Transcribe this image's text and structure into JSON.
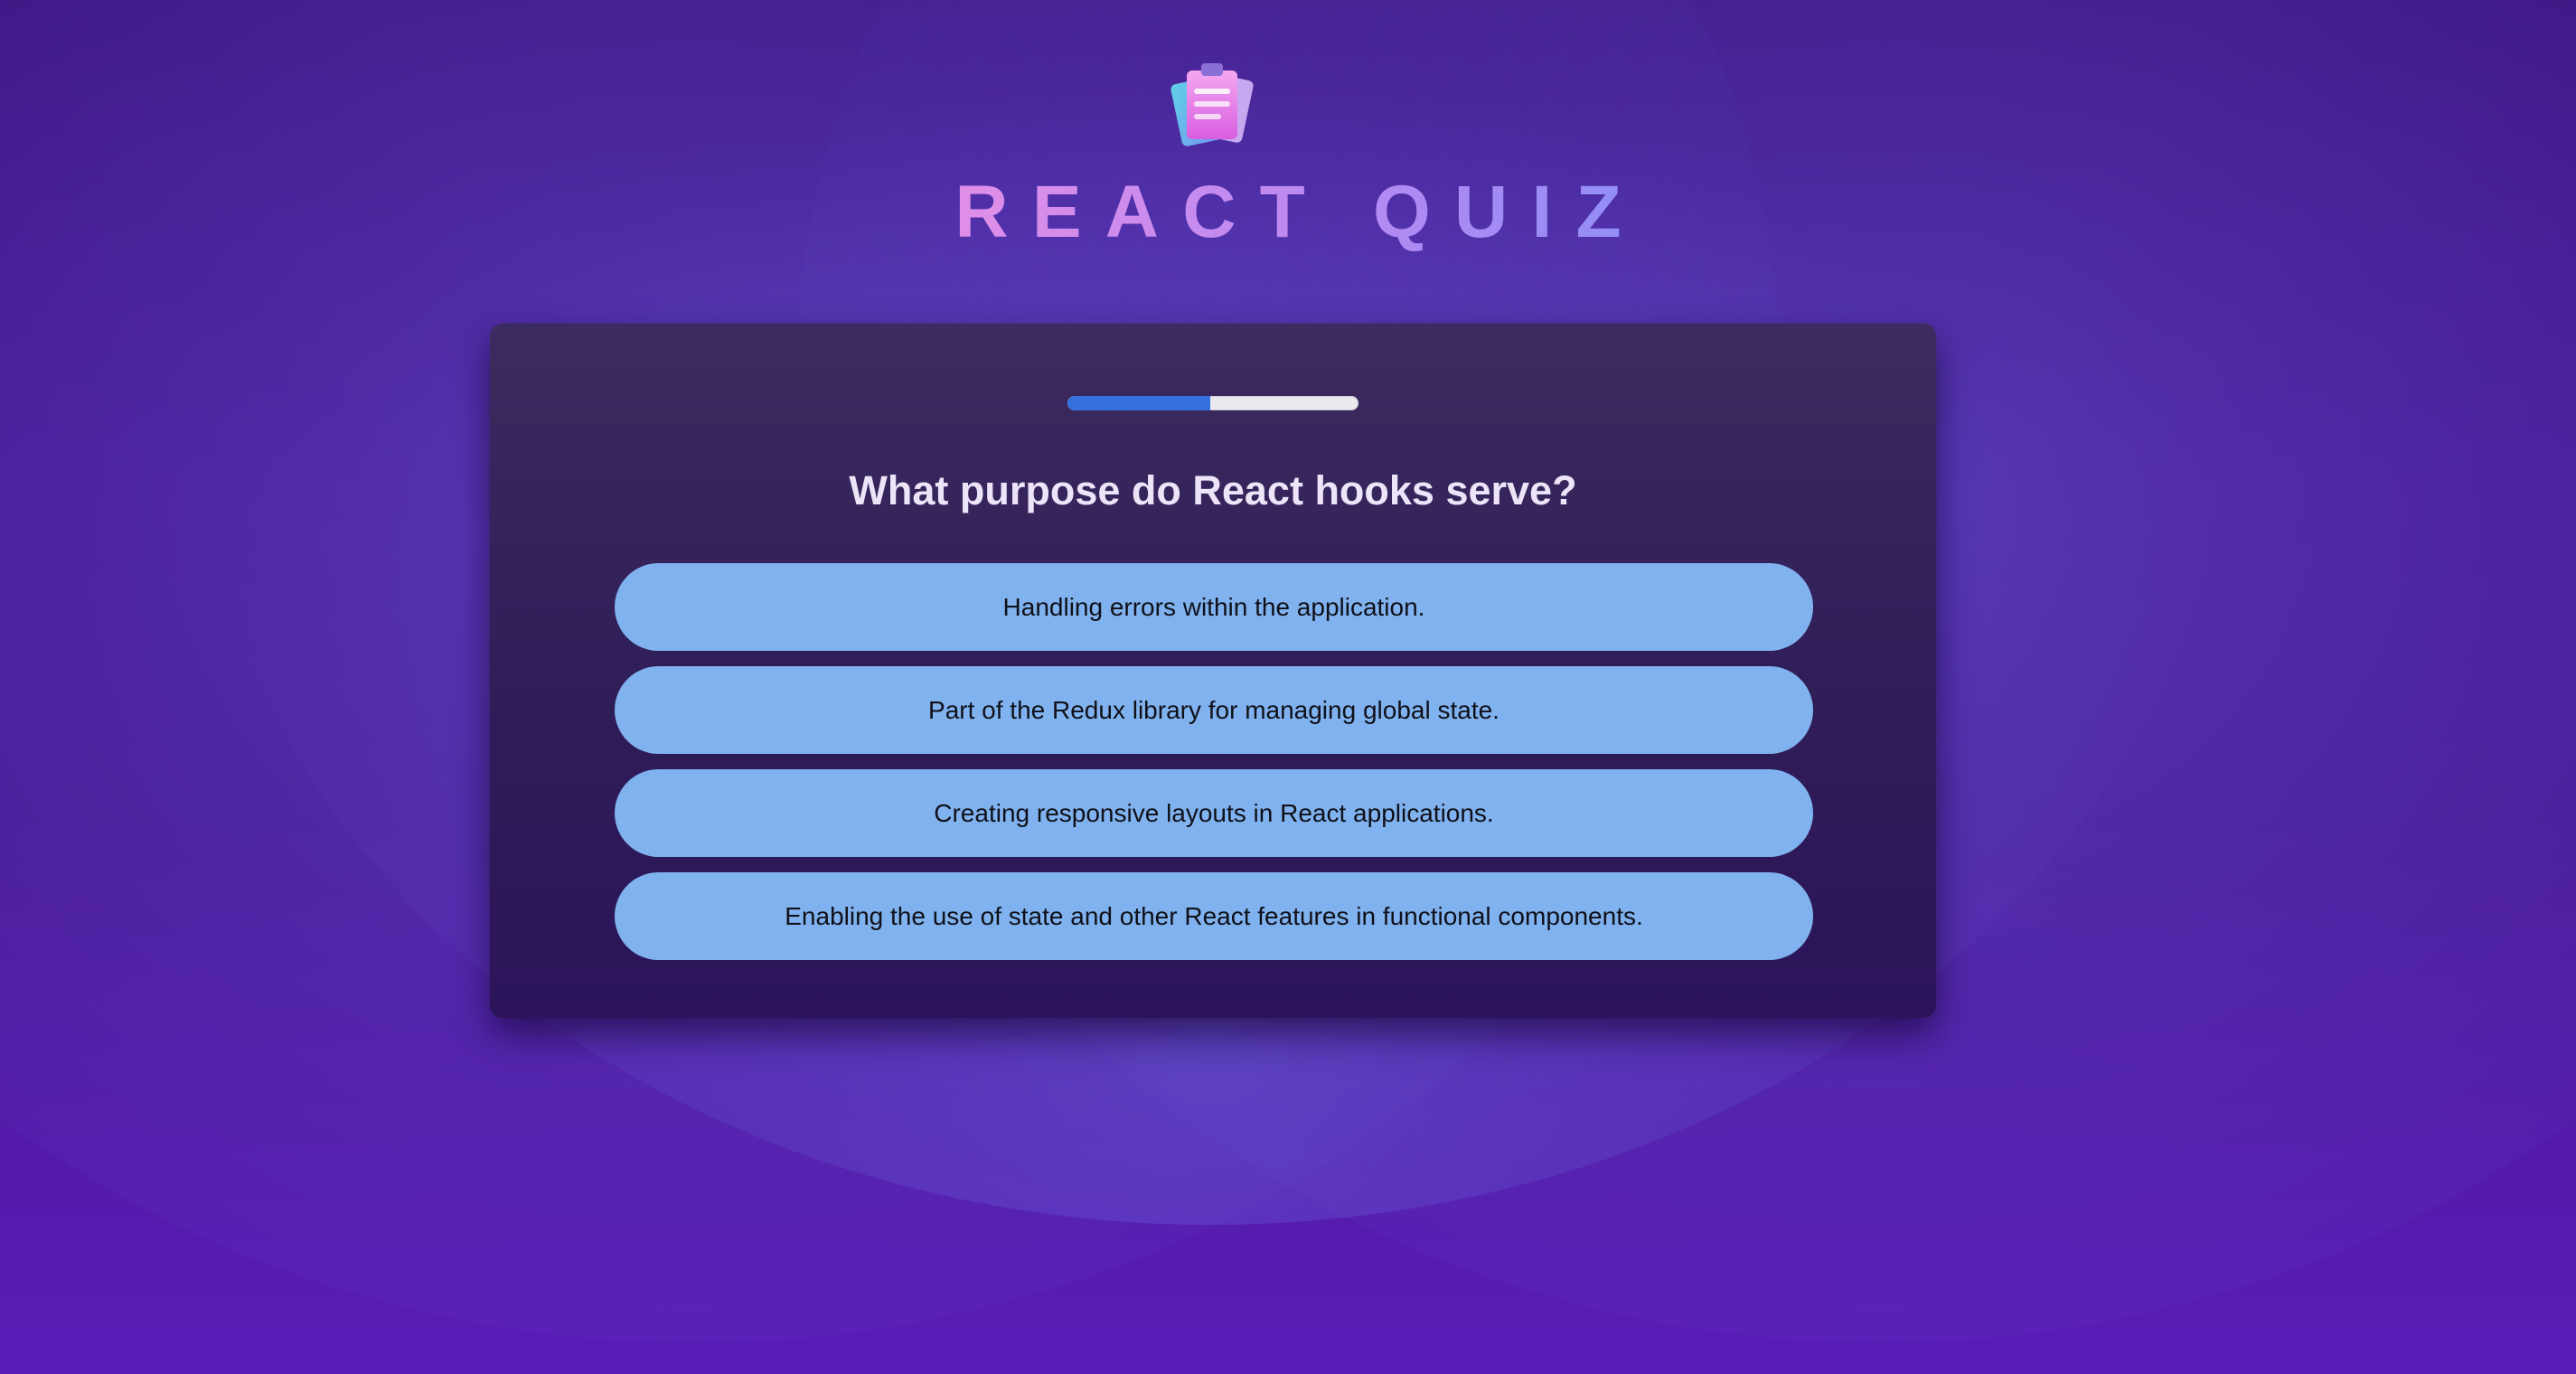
{
  "app": {
    "title": "REACT QUIZ",
    "logo_icon": "clipboard-quiz-icon"
  },
  "progress": {
    "fraction": 0.49
  },
  "quiz": {
    "question": "What purpose do React hooks serve?",
    "options": [
      "Handling errors within the application.",
      "Part of the Redux library for managing global state.",
      "Creating responsive layouts in React applications.",
      "Enabling the use of state and other React features in functional components."
    ]
  },
  "colors": {
    "background": "#4a1696",
    "card": "#2f1d58",
    "option": "#7fb2ee",
    "progress_fill": "#3571de",
    "title_gradient_start": "#e08ee8",
    "title_gradient_end": "#8f8ef6"
  }
}
